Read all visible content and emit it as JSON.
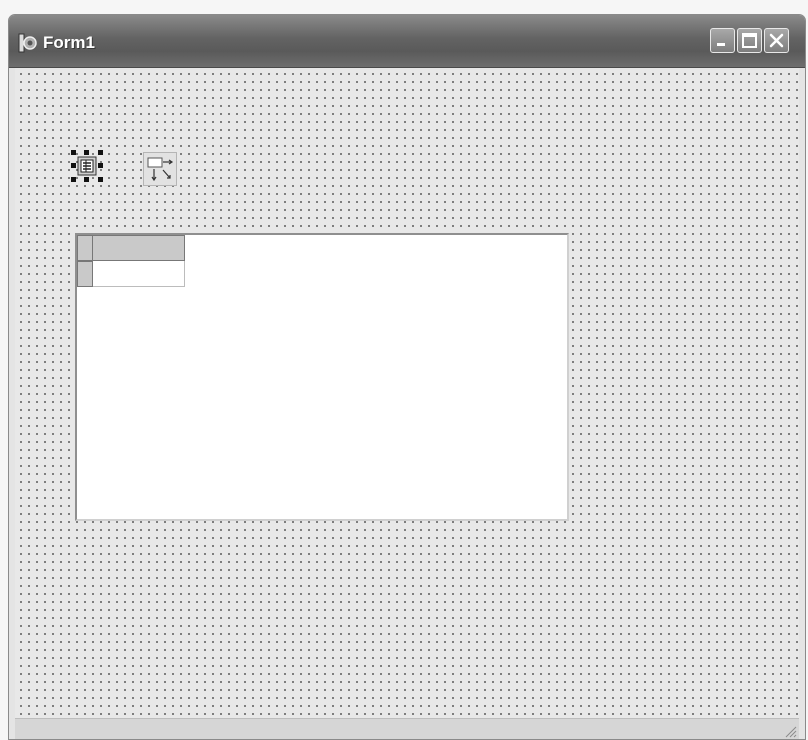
{
  "window": {
    "title": "Form1"
  },
  "icons": {
    "app": "delphi-form-icon",
    "minimize": "minimize-icon",
    "maximize": "maximize-icon",
    "close": "close-icon",
    "datasource_component": "datasource-component-icon",
    "table_component": "table-component-icon",
    "size_grip": "size-grip-icon"
  },
  "designer": {
    "grid_rows": 2,
    "grid_cols": 2
  },
  "colors": {
    "titlebar": "#636363",
    "form_background": "#e8e8e8",
    "grid_dots": "#6a6a6a",
    "grid_fixed": "#c9c9c9"
  }
}
